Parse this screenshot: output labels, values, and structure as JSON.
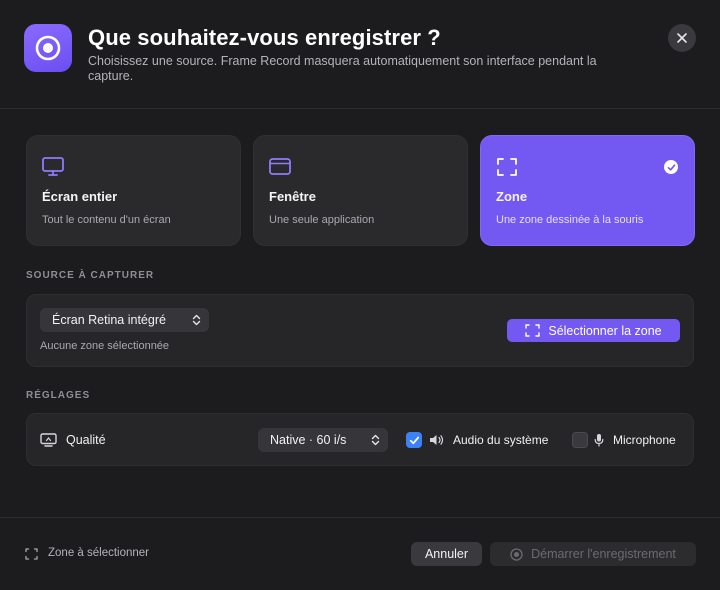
{
  "header": {
    "title": "Que souhaitez-vous enregistrer ?",
    "subtitle": "Choisissez une source. Frame Record masquera automatiquement son interface pendant la capture.",
    "close_label": "×"
  },
  "sources": [
    {
      "title": "Écran entier",
      "description": "Tout le contenu d'un écran",
      "icon": "monitor-icon",
      "selected": false
    },
    {
      "title": "Fenêtre",
      "description": "Une seule application",
      "icon": "window-icon",
      "selected": false
    },
    {
      "title": "Zone",
      "description": "Une zone dessinée à la souris",
      "icon": "crop-frame-icon",
      "selected": true
    }
  ],
  "capture": {
    "section_label": "SOURCE À CAPTURER",
    "display_select": "Écran Retina intégré",
    "status": "Aucune zone sélectionnée",
    "select_zone_button": "Sélectionner la zone"
  },
  "settings": {
    "section_label": "RÉGLAGES",
    "quality_label": "Qualité",
    "quality_select": "Native · 60 i/s",
    "system_audio_label": "Audio du système",
    "system_audio_checked": true,
    "microphone_label": "Microphone",
    "microphone_checked": false
  },
  "footer": {
    "status": "Zone à sélectionner",
    "cancel_label": "Annuler",
    "start_label": "Démarrer l'enregistrement"
  },
  "colors": {
    "background": "#1c1c1e",
    "accent": "#7458f2",
    "checkbox_blue": "#3b82f6",
    "panel": "#262629"
  }
}
